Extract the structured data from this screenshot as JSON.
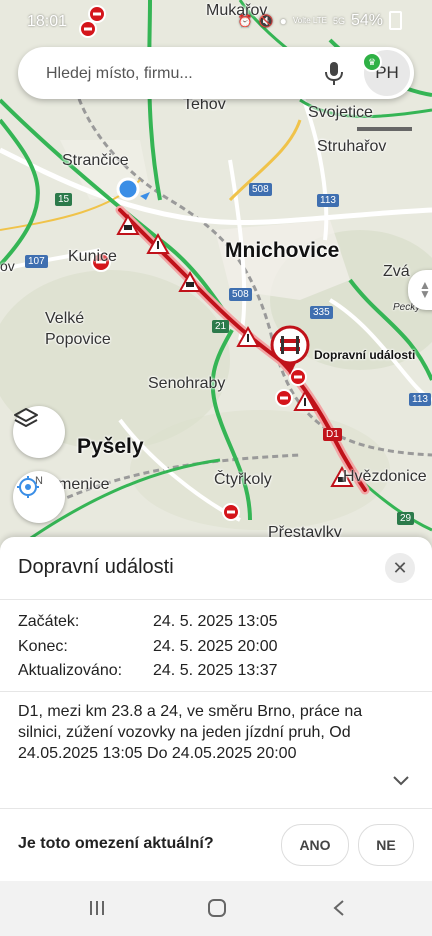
{
  "status_bar": {
    "time": "18:01",
    "battery": "54%",
    "net": "Volte LTE",
    "signal_extra": "5G"
  },
  "search": {
    "placeholder": "Hledej místo, firmu..."
  },
  "avatar": {
    "initials": "PH"
  },
  "map": {
    "places": {
      "mukarov": "Mukařov",
      "tehov": "Tehov",
      "svojetice": "Svojetice",
      "struharov": "Struhařov",
      "strancice": "Strančice",
      "mnichovice": "Mnichovice",
      "kunice": "Kunice",
      "velke_popovice": "Velké\nPopovice",
      "senohraby": "Senohraby",
      "pysely": "Pyšely",
      "menice": "menice",
      "ctyrkoly": "Čtyřkoly",
      "hrusice": "Hrušice",
      "hvezdonice": "Hvězdonice",
      "prestavlky": "Přestavlky",
      "zv": "Zvá",
      "pecky": "Pecky",
      "ov": "ov"
    },
    "shields": {
      "r15": "15",
      "r107": "107",
      "r508a": "508",
      "r508b": "508",
      "r113a": "113",
      "r113b": "113",
      "r335": "335",
      "r21": "21",
      "rd1": "D1",
      "r29": "29"
    },
    "event_label": "Dopravní události",
    "compass_letter": "N"
  },
  "sheet": {
    "title": "Dopravní události",
    "rows": [
      {
        "label": "Začátek:",
        "value": "24. 5. 2025 13:05"
      },
      {
        "label": "Konec:",
        "value": "24. 5. 2025 20:00"
      },
      {
        "label": "Aktualizováno:",
        "value": "24. 5. 2025 13:37"
      }
    ],
    "description": "D1, mezi km 23.8 a 24, ve směru Brno, práce na silnici, zúžení vozovky na jeden jízdní pruh, Od 24.05.2025 13:05 Do 24.05.2025 20:00",
    "question": "Je toto omezení aktuální?",
    "yes": "ANO",
    "no": "NE"
  },
  "colors": {
    "route_red": "#c0121a",
    "road_green": "#35b555",
    "road_yellow": "#f0c34a"
  }
}
